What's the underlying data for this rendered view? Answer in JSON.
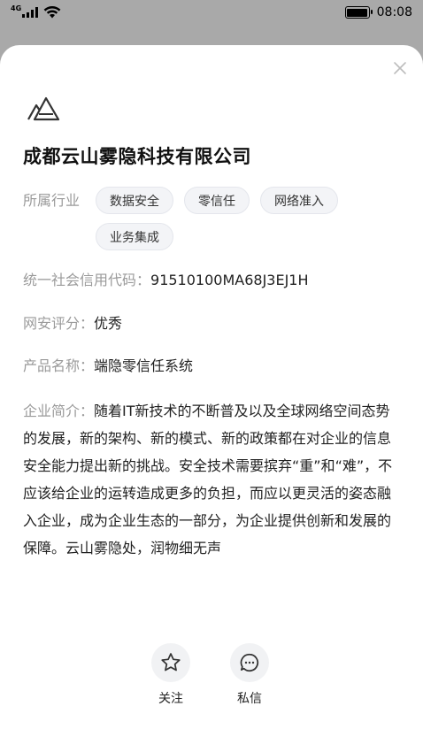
{
  "status_bar": {
    "network": "4G",
    "time": "08:08"
  },
  "company": {
    "name": "成都云山雾隐科技有限公司",
    "industry_label": "所属行业",
    "industry_tags": [
      "数据安全",
      "零信任",
      "网络准入",
      "业务集成"
    ],
    "credit_code_label": "统一社会信用代码：",
    "credit_code": "91510100MA68J3EJ1H",
    "rating_label": "网安评分：",
    "rating": "优秀",
    "product_label": "产品名称：",
    "product": "端隐零信任系统",
    "intro_label": "企业简介：",
    "intro": "随着IT新技术的不断普及以及全球网络空间态势的发展，新的架构、新的模式、新的政策都在对企业的信息安全能力提出新的挑战。安全技术需要摈弃“重”和“难”，不应该给企业的运转造成更多的负担，而应以更灵活的姿态融入企业，成为企业生态的一部分，为企业提供创新和发展的保障。云山雾隐处，润物细无声"
  },
  "actions": {
    "follow_label": "关注",
    "message_label": "私信"
  }
}
